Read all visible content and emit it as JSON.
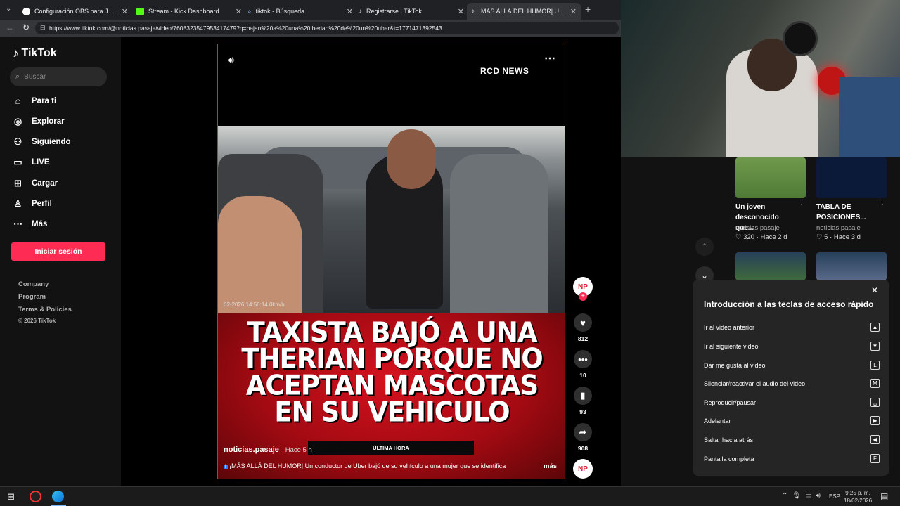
{
  "browser": {
    "tabs": [
      {
        "title": "Configuración OBS para Jugar",
        "color": "#ffffff"
      },
      {
        "title": "Stream - Kick Dashboard",
        "color": "#53fc18"
      },
      {
        "title": "tiktok - Búsqueda",
        "color": "#4a8cff"
      },
      {
        "title": "Registrarse | TikTok",
        "color": "#000000"
      },
      {
        "title": "¡MÁS ALLÁ DEL HUMOR| Un co",
        "color": "#000000"
      }
    ],
    "url": "https://www.tiktok.com/@noticias.pasaje/video/7608323547953417479?q=bajan%20a%20una%20therian%20de%20un%20uber&t=1771471392543"
  },
  "sidebar": {
    "logo": "TikTok",
    "search_placeholder": "Buscar",
    "items": [
      {
        "label": "Para ti",
        "icon": "home-icon"
      },
      {
        "label": "Explorar",
        "icon": "compass-icon"
      },
      {
        "label": "Siguiendo",
        "icon": "following-icon"
      },
      {
        "label": "LIVE",
        "icon": "live-icon"
      },
      {
        "label": "Cargar",
        "icon": "upload-icon"
      },
      {
        "label": "Perfil",
        "icon": "profile-icon"
      },
      {
        "label": "Más",
        "icon": "more-icon"
      }
    ],
    "login_label": "Iniciar sesión",
    "footer": [
      "Company",
      "Program",
      "Terms & Policies",
      "© 2026 TikTok"
    ]
  },
  "video": {
    "channel_badge": "RCD NEWS",
    "timestamp_overlay": "02-2026  14:56:14    0km/h",
    "headline": "TAXISTA BAJÓ A UNA THERIAN PORQUE NO ACEPTAN MASCOTAS EN SU VEHICULO",
    "ticker": "ÚLTIMA HORA",
    "author": "noticias.pasaje",
    "time_ago": "· Hace 5 h",
    "caption": "¡MÁS ALLÁ DEL HUMOR| Un conductor de Uber bajó de su vehículo a una mujer que se identifica",
    "more_label": "más",
    "avatar_initials": "NP"
  },
  "actions": {
    "likes": "812",
    "comments": "10",
    "saves": "93",
    "shares": "908"
  },
  "related": [
    {
      "title": "Un joven desconocido que...",
      "author": "noticias.pasaje",
      "stats": "320 · Hace 2 d"
    },
    {
      "title": "TABLA DE POSICIONES...",
      "author": "noticias.pasaje",
      "stats": "5 · Hace 3 d"
    }
  ],
  "shortcuts": {
    "title": "Introducción a las teclas de acceso rápido",
    "items": [
      {
        "label": "Ir al video anterior",
        "key": "▲"
      },
      {
        "label": "Ir al siguiente video",
        "key": "▼"
      },
      {
        "label": "Dar me gusta al video",
        "key": "L"
      },
      {
        "label": "Silenciar/reactivar el audio del video",
        "key": "M"
      },
      {
        "label": "Reproducir/pausar",
        "key": "␣"
      },
      {
        "label": "Adelantar",
        "key": "▶"
      },
      {
        "label": "Saltar hacia atrás",
        "key": "◀"
      },
      {
        "label": "Pantalla completa",
        "key": "F"
      }
    ]
  },
  "taskbar": {
    "time": "9:25 p. m.",
    "date": "18/02/2026",
    "lang": "ESP"
  },
  "colors": {
    "accent": "#fe2c55",
    "video_border": "#e0243c"
  }
}
